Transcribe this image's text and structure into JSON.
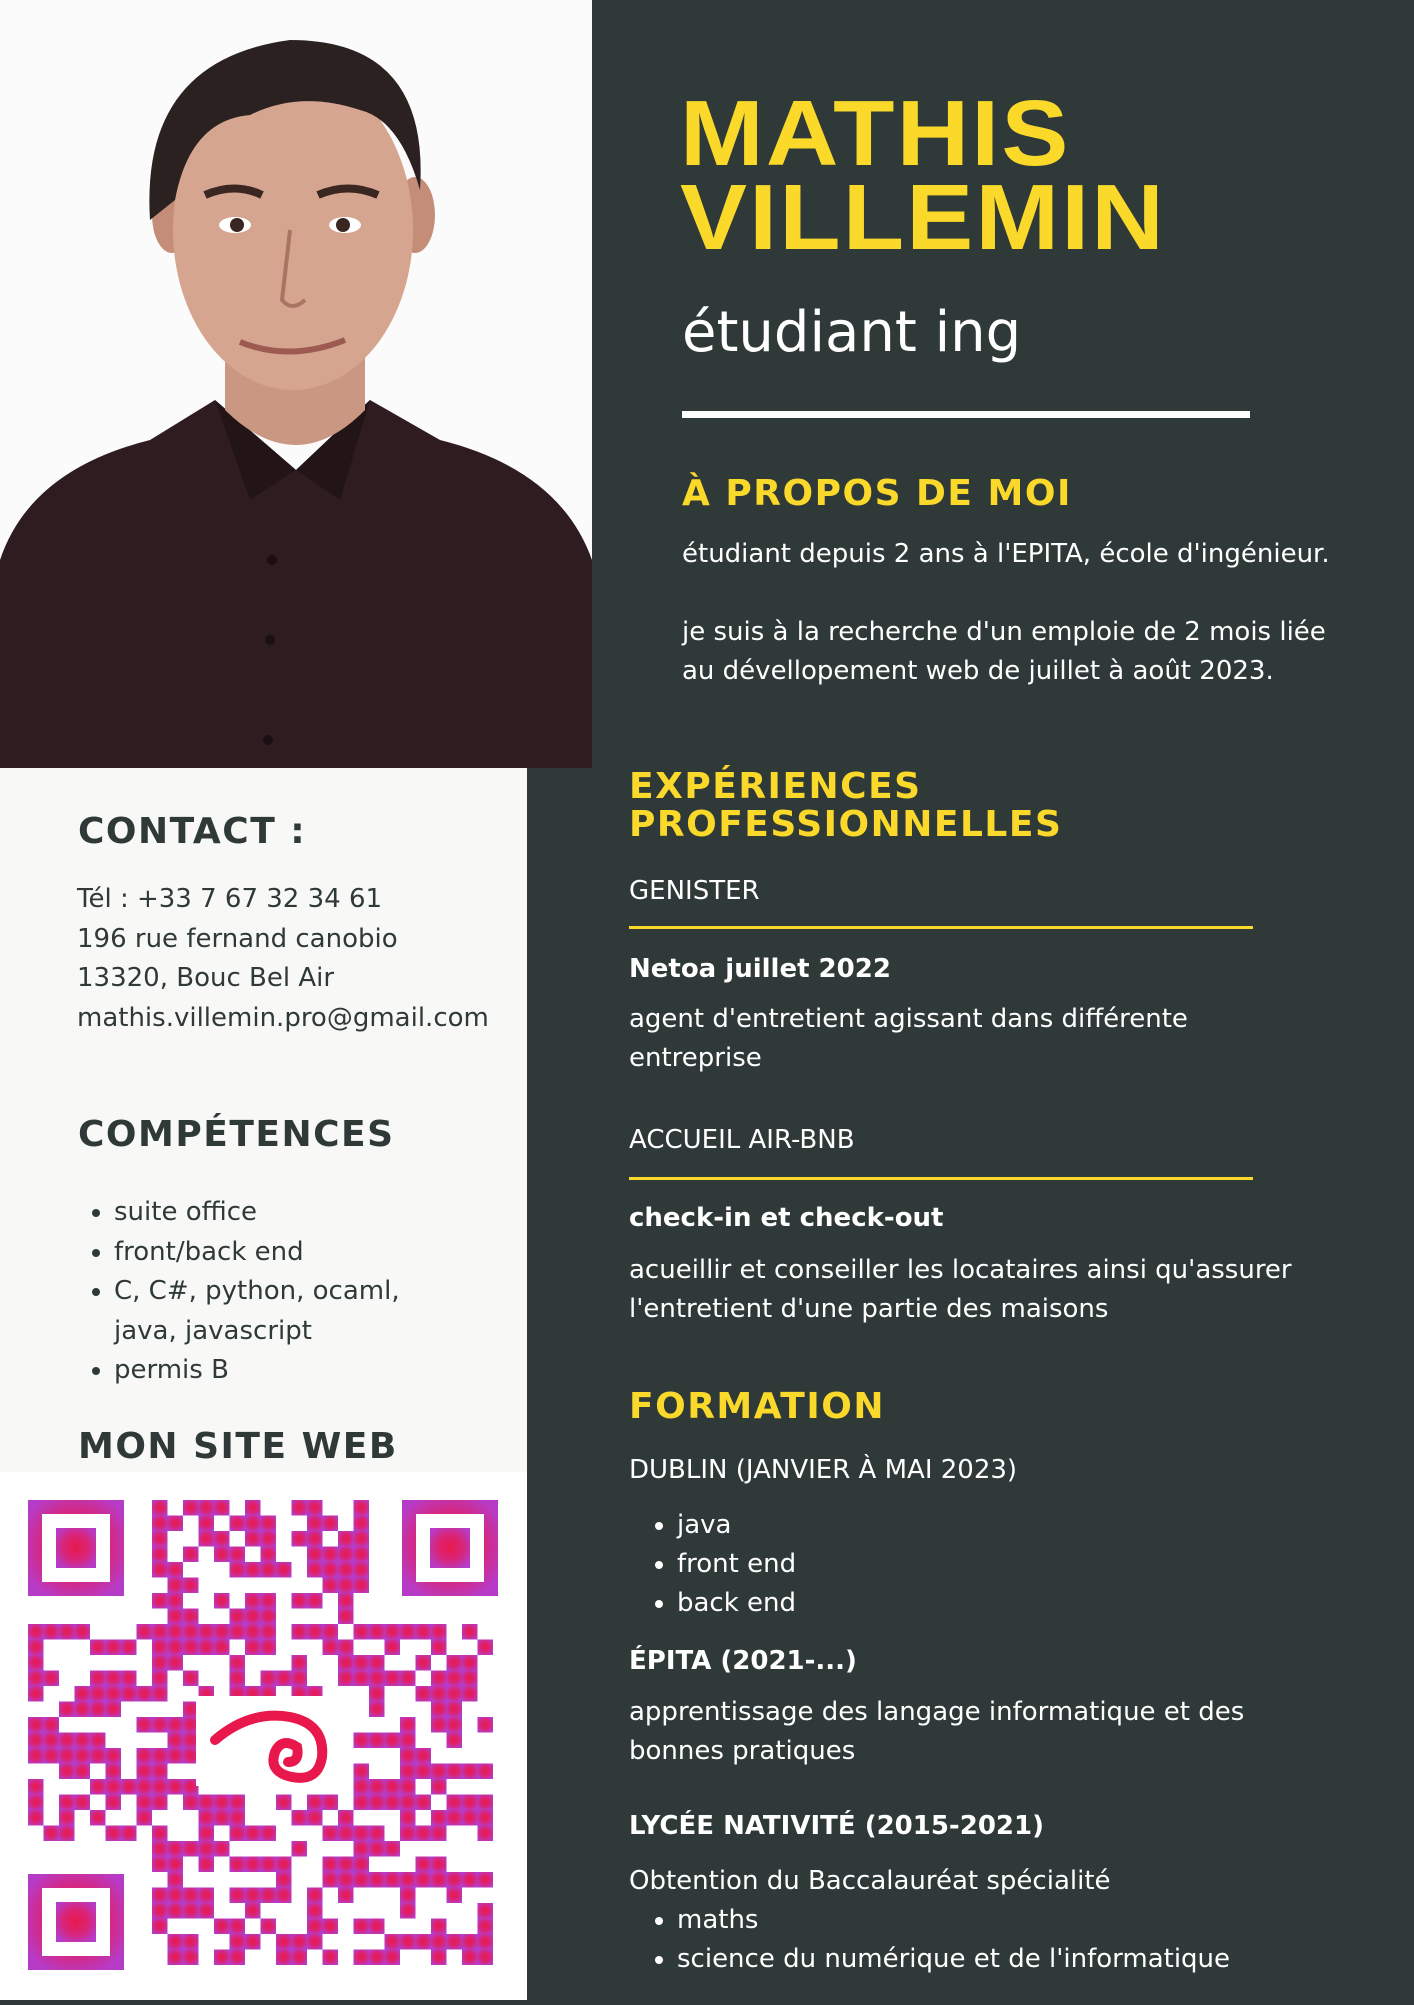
{
  "header": {
    "first_name": "MATHIS",
    "last_name": "VILLEMIN",
    "subtitle": "étudiant ing"
  },
  "about": {
    "title": "À PROPOS DE MOI",
    "paragraph_1": "étudiant  depuis 2 ans à l'EPITA, école d'ingénieur.",
    "paragraph_2_line_1": "je suis à la recherche d'un emploie de 2 mois liée",
    "paragraph_2_line_2": "au dévellopement web de juillet à août 2023."
  },
  "contact": {
    "title": "CONTACT :",
    "phone": "Tél : +33 7 67 32 34 61",
    "address_1": "196 rue fernand canobio",
    "address_2": "13320, Bouc Bel Air",
    "email": "mathis.villemin.pro@gmail.com"
  },
  "skills": {
    "title": "COMPÉTENCES",
    "items": [
      "suite office",
      "front/back end",
      "C, C#, python, ocaml,",
      "java, javascript",
      "permis B"
    ]
  },
  "website": {
    "title": "MON SITE WEB"
  },
  "experience": {
    "title_line_1": "EXPÉRIENCES",
    "title_line_2": "PROFESSIONNELLES",
    "jobs": [
      {
        "company": "GENISTER",
        "role": "Netoa juillet 2022",
        "desc_line_1": "agent d'entretient agissant dans différente",
        "desc_line_2": "entreprise"
      },
      {
        "company": "ACCUEIL AIR-BNB",
        "role": "check-in et check-out",
        "desc_line_1": "acueillir et conseiller les locataires ainsi qu'assurer",
        "desc_line_2": "l'entretient d'une partie des maisons"
      }
    ]
  },
  "education": {
    "title": "FORMATION",
    "dublin": {
      "heading": "DUBLIN (JANVIER À MAI 2023)",
      "items": [
        "java",
        "front end",
        "back end"
      ]
    },
    "epita": {
      "heading": "ÉPITA (2021-...)",
      "desc_line_1": "apprentissage des langage informatique et des",
      "desc_line_2": "bonnes pratiques"
    },
    "lycee": {
      "heading": "LYCÉE NATIVITÉ (2015-2021)",
      "desc": "Obtention du Baccalauréat spécialité",
      "items": [
        "maths",
        "science du numérique et de l'informatique"
      ]
    }
  },
  "colors": {
    "dark": "#2f3a38",
    "accent": "#fbd92a",
    "qr_magenta": "#b83cc4",
    "qr_red": "#e8184c"
  }
}
